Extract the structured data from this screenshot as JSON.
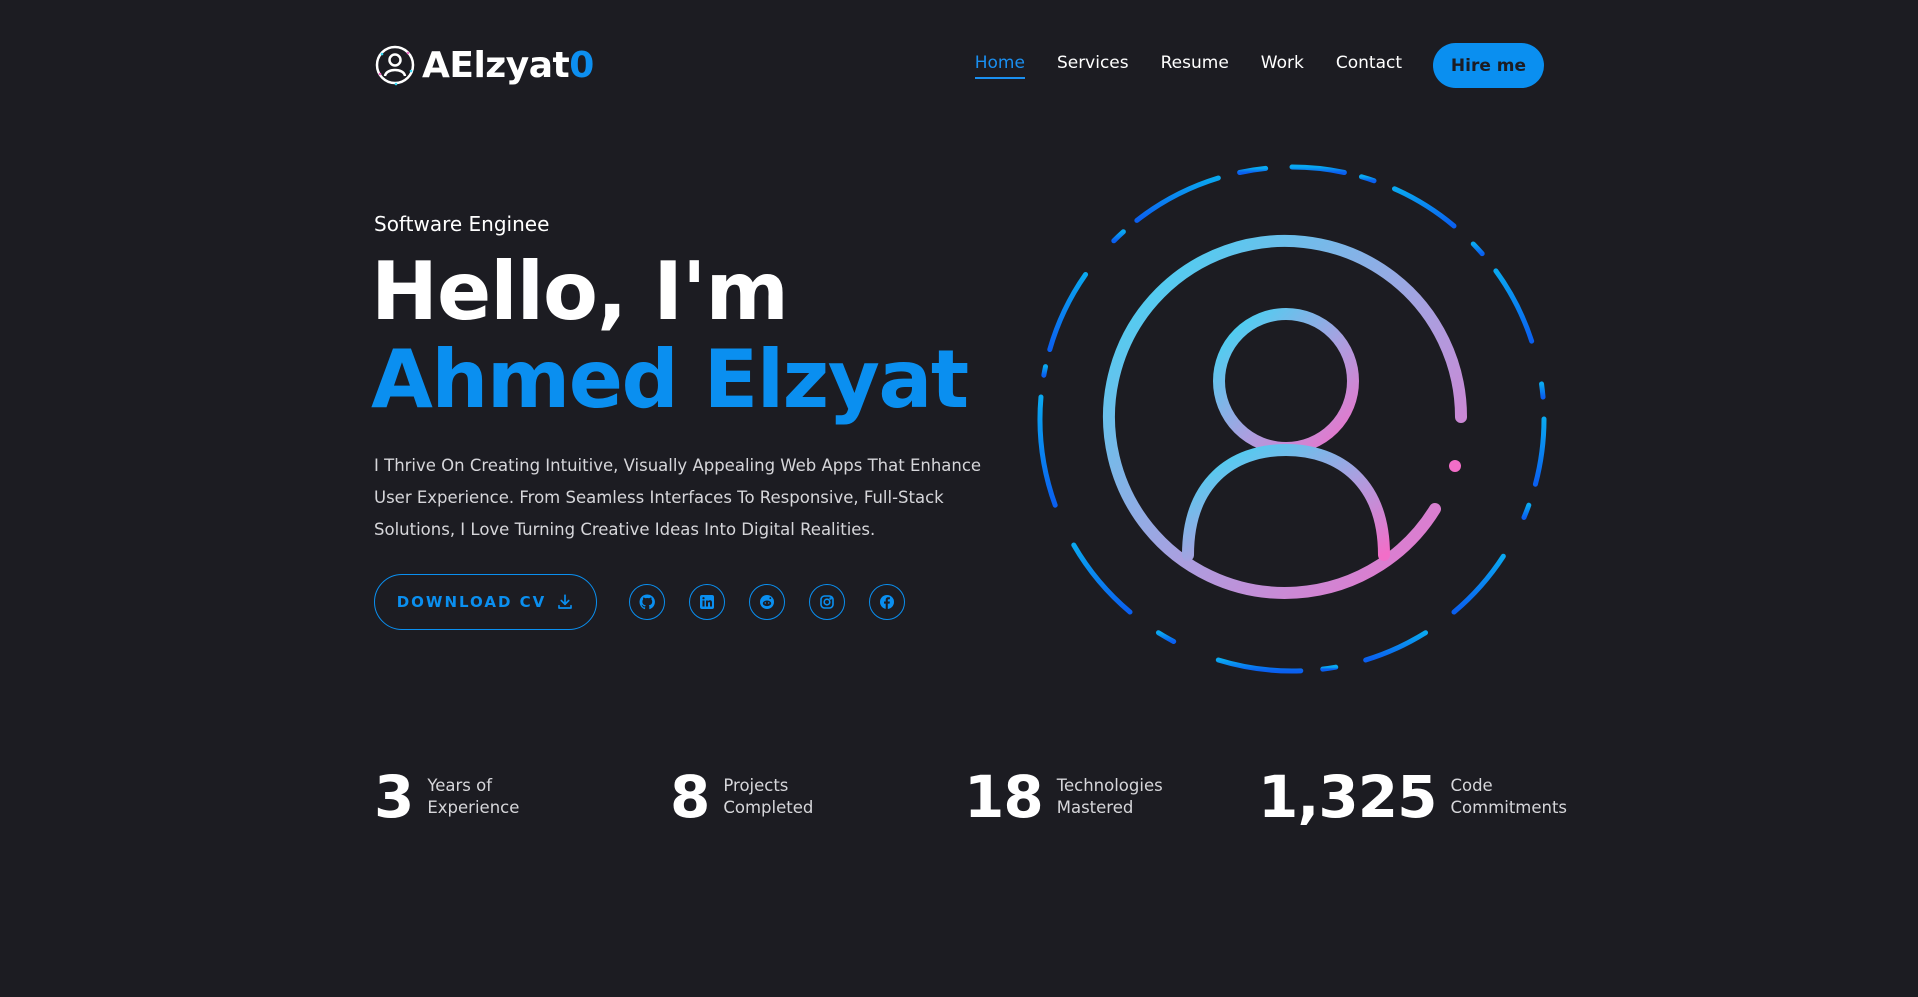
{
  "brand": {
    "name_main": "AElzyat",
    "name_accent": "0",
    "logo_icon": "user-circle-logo-icon"
  },
  "nav": {
    "items": [
      {
        "label": "Home",
        "active": true
      },
      {
        "label": "Services",
        "active": false
      },
      {
        "label": "Resume",
        "active": false
      },
      {
        "label": "Work",
        "active": false
      },
      {
        "label": "Contact",
        "active": false
      }
    ],
    "hire_label": "Hire me"
  },
  "hero": {
    "role": "Software Enginee",
    "greeting": "Hello, I'm",
    "name": "Ahmed Elzyat",
    "bio": "I Thrive On Creating Intuitive, Visually Appealing Web Apps That Enhance User Experience. From Seamless Interfaces To Responsive, Full-Stack Solutions, I Love Turning Creative Ideas Into Digital Realities.",
    "cv_label": "DOWNLOAD CV",
    "cv_icon": "download-icon",
    "socials": [
      {
        "icon": "github-icon"
      },
      {
        "icon": "linkedin-icon"
      },
      {
        "icon": "reddit-icon"
      },
      {
        "icon": "instagram-icon"
      },
      {
        "icon": "facebook-icon"
      }
    ],
    "illustration_icon": "user-avatar-icon"
  },
  "stats": [
    {
      "value": "3",
      "label_line1": "Years of",
      "label_line2": "Experience"
    },
    {
      "value": "8",
      "label_line1": "Projects",
      "label_line2": "Completed"
    },
    {
      "value": "18",
      "label_line1": "Technologies",
      "label_line2": "Mastered"
    },
    {
      "value": "1,325",
      "label_line1": "Code",
      "label_line2": "Commitments"
    }
  ],
  "colors": {
    "background": "#1c1c22",
    "accent": "#0a8ff0",
    "gradient_cyan": "#38d9f5",
    "gradient_pink": "#f26ec8"
  }
}
